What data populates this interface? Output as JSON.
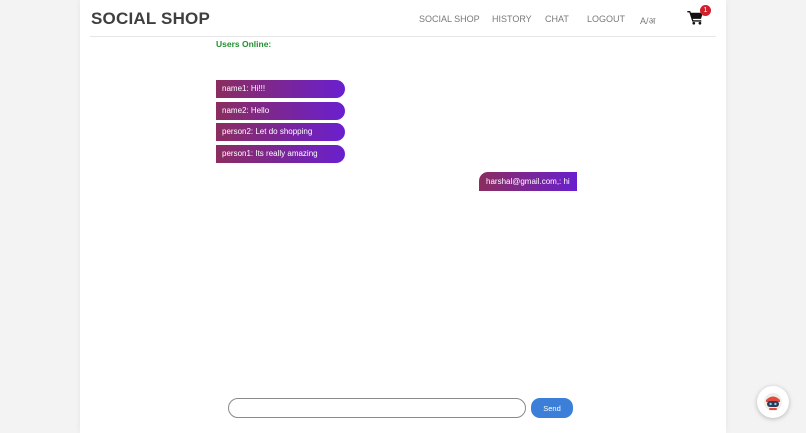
{
  "brand": "SOCIAL SHOP",
  "nav": {
    "items": [
      {
        "label": "SOCIAL SHOP"
      },
      {
        "label": "HISTORY"
      },
      {
        "label": "CHAT"
      },
      {
        "label": "LOGOUT"
      },
      {
        "label": "A/अ"
      }
    ],
    "cart": {
      "icon": "shopping-cart-icon",
      "count": "1",
      "badge_color": "#d0202e"
    }
  },
  "chat": {
    "users_online_label": "Users Online:",
    "messages": [
      {
        "text": "name1: Hi!!!"
      },
      {
        "text": "name2: Hello"
      },
      {
        "text": "person2: Let do shopping"
      },
      {
        "text": "person1: Its really amazing"
      }
    ],
    "own_message": {
      "text": "harshal@gmail.com,: hi"
    },
    "bubble_gradient": [
      "#8b2d5f",
      "#6a1fcf"
    ],
    "input": {
      "value": "",
      "placeholder": ""
    },
    "send_label": "Send",
    "send_color": "#3b7fd9"
  },
  "widget": {
    "icon": "chatbot-icon"
  },
  "colors": {
    "users_online": "#1f8f2f",
    "brand_text": "#3f3f3f",
    "nav_text": "#7a7a7a"
  }
}
